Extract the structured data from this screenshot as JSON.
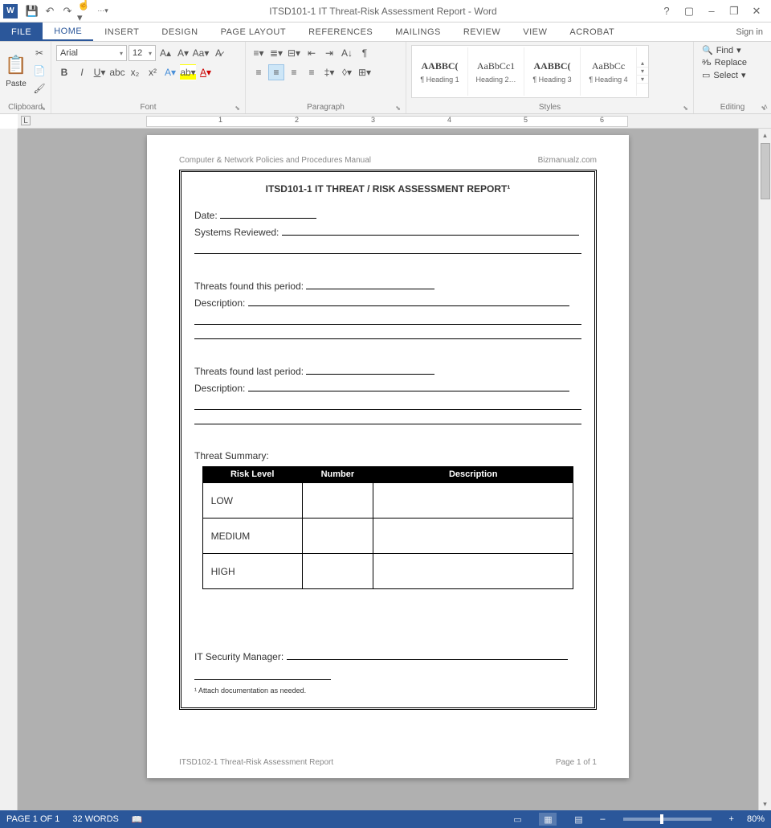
{
  "titlebar": {
    "title": "ITSD101-1 IT Threat-Risk Assessment Report - Word"
  },
  "win": {
    "help": "?",
    "ribbonopts": "▢",
    "min": "–",
    "restore": "❐",
    "close": "✕"
  },
  "tabs": {
    "file": "FILE",
    "home": "HOME",
    "insert": "INSERT",
    "design": "DESIGN",
    "layout": "PAGE LAYOUT",
    "references": "REFERENCES",
    "mailings": "MAILINGS",
    "review": "REVIEW",
    "view": "VIEW",
    "acrobat": "ACROBAT",
    "signin": "Sign in"
  },
  "ribbon": {
    "clipboard": {
      "paste": "Paste",
      "label": "Clipboard"
    },
    "font": {
      "name": "Arial",
      "size": "12",
      "label": "Font"
    },
    "paragraph": {
      "label": "Paragraph"
    },
    "styles": {
      "label": "Styles",
      "items": [
        {
          "prev": "AABBC(",
          "name": "¶ Heading 1"
        },
        {
          "prev": "AaBbCc1",
          "name": "Heading 2…"
        },
        {
          "prev": "AABBC(",
          "name": "¶ Heading 3"
        },
        {
          "prev": "AaBbCc",
          "name": "¶ Heading 4"
        }
      ]
    },
    "editing": {
      "find": "Find",
      "replace": "Replace",
      "select": "Select",
      "label": "Editing"
    }
  },
  "ruler": {
    "L": "L",
    "nums": [
      "1",
      "2",
      "3",
      "4",
      "5",
      "6"
    ]
  },
  "doc": {
    "header_left": "Computer & Network Policies and Procedures Manual",
    "header_right": "Bizmanualz.com",
    "title": "ITSD101-1   IT THREAT / RISK ASSESSMENT REPORT¹",
    "date": "Date:",
    "systems": "Systems Reviewed:",
    "threats_this": "Threats found this period:",
    "desc": "Description:",
    "threats_last": "Threats found last period:",
    "summary": "Threat Summary:",
    "th_risk": "Risk Level",
    "th_num": "Number",
    "th_desc": "Description",
    "row_low": "LOW",
    "row_med": "MEDIUM",
    "row_high": "HIGH",
    "manager": "IT Security Manager:",
    "footnote": "¹ Attach documentation as needed.",
    "footer_left": "ITSD102-1 Threat-Risk Assessment Report",
    "footer_right": "Page 1 of 1"
  },
  "status": {
    "page": "PAGE 1 OF 1",
    "words": "32 WORDS",
    "zoom": "80%"
  }
}
